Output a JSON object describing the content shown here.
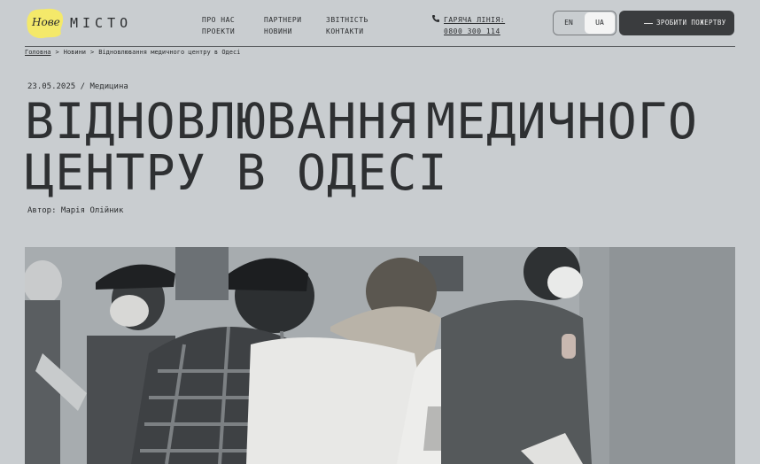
{
  "logo": {
    "script_text": "Нове",
    "wordmark": "МІСТО",
    "blob_color": "#f4e96a"
  },
  "nav": {
    "col1": [
      "ПРО НАС",
      "ПРОЕКТИ"
    ],
    "col2": [
      "ПАРТНЕРИ",
      "НОВИНИ"
    ],
    "col3": [
      "ЗВІТНІСТЬ",
      "КОНТАКТИ"
    ]
  },
  "hotline": {
    "label": "ГАРЯЧА ЛІНІЯ:",
    "number": "0800 300 114",
    "icon": "phone-icon"
  },
  "lang": {
    "en": "EN",
    "ua": "UA",
    "active": "UA"
  },
  "donate_label": "ЗРОБИТИ ПОЖЕРТВУ",
  "breadcrumb": {
    "home": "Головна",
    "news": "Новини",
    "current": "Відновлювання медичного центру в Одесі"
  },
  "article": {
    "date": "23.05.2025",
    "separator": "/",
    "category": "Медицина",
    "title_line1_word1": "ВІДНОВЛЮВАННЯ",
    "title_line1_word2": "МЕДИЧНОГО",
    "title_line2": "ЦЕНТРУ В ОДЕСІ",
    "author": "Автор: Марія Олійник"
  },
  "colors": {
    "background": "#c9cdd0",
    "text": "#2b2d2f",
    "button_dark": "#3a3c3e"
  }
}
